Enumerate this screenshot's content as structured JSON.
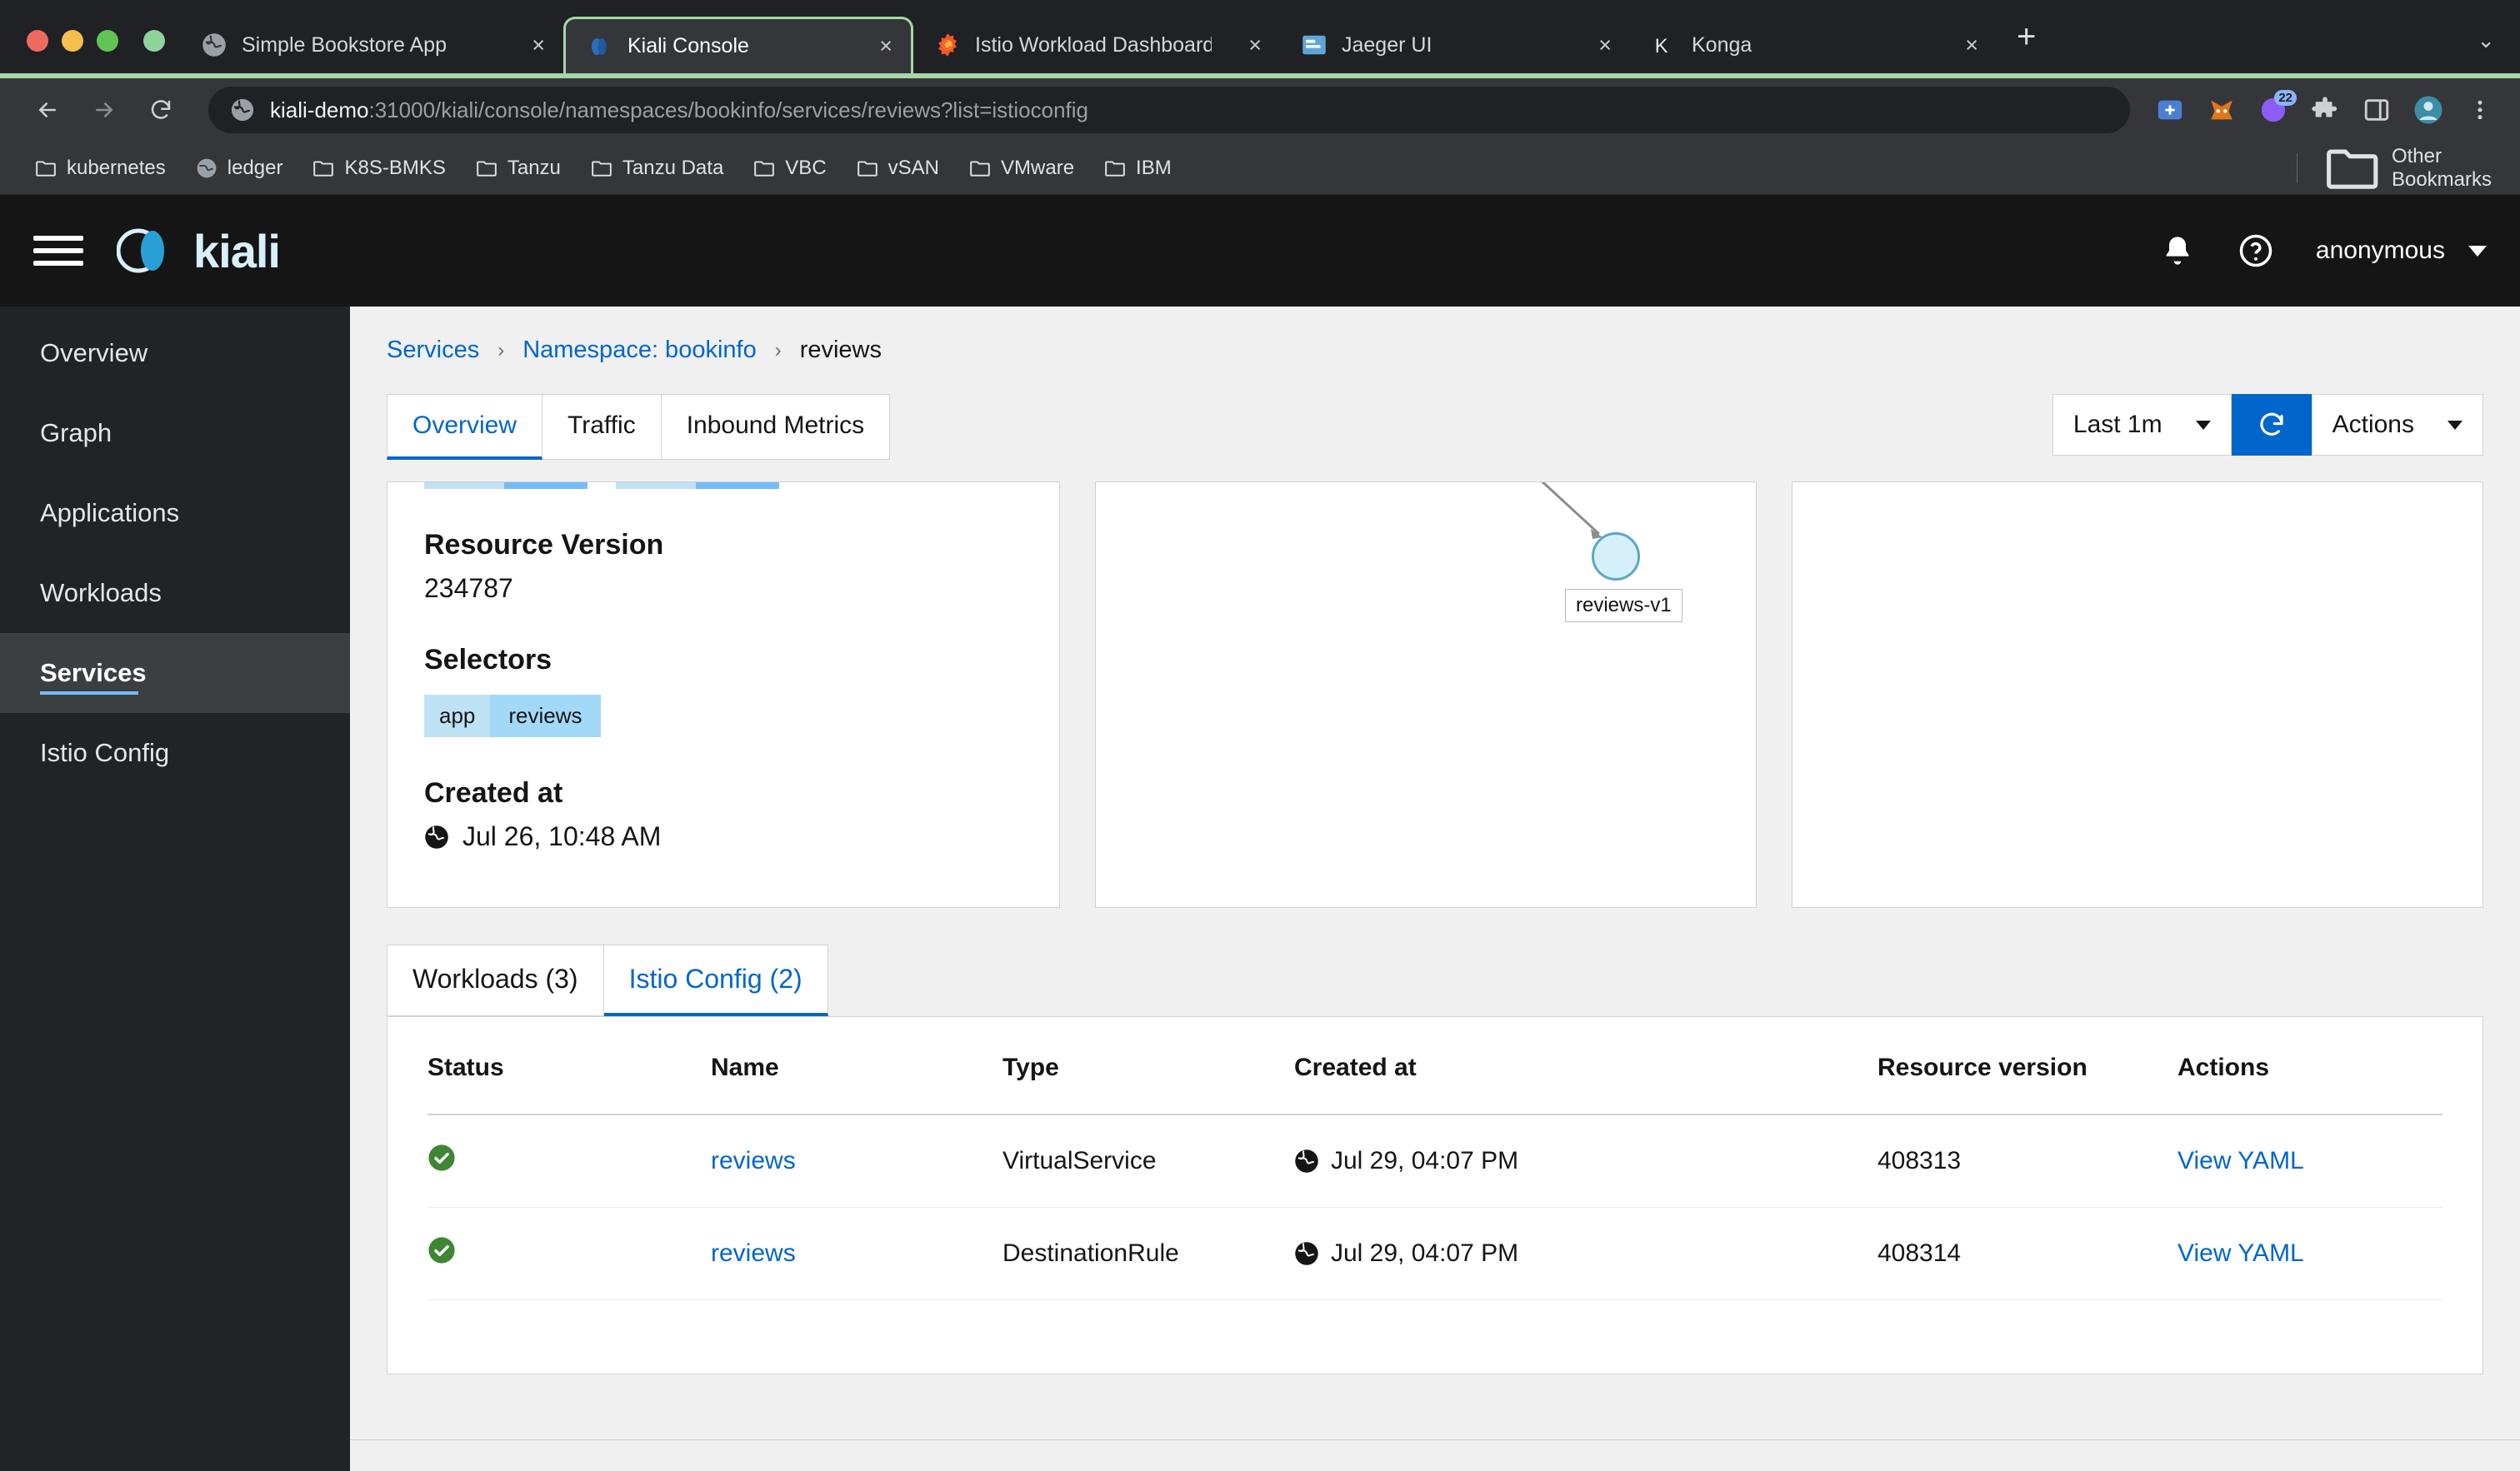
{
  "browser": {
    "tabs": [
      {
        "title": "Simple Bookstore App",
        "favicon": "globe-icon",
        "close": "×",
        "active": false
      },
      {
        "title": "Kiali Console",
        "favicon": "kiali-icon",
        "close": "×",
        "active": true
      },
      {
        "title": "Istio Workload Dashboard - Gra",
        "favicon": "grafana-icon",
        "close": "×",
        "active": false
      },
      {
        "title": "Jaeger UI",
        "favicon": "jaeger-icon",
        "close": "×",
        "active": false
      },
      {
        "title": "Konga",
        "favicon": "konga-icon",
        "close": "×",
        "active": false
      }
    ],
    "new_tab_label": "+",
    "tabstrip_overflow": "⌄",
    "omnibox": {
      "host": "kiali-demo",
      "path": ":31000/kiali/console/namespaces/bookinfo/services/reviews?list=istioconfig",
      "full_url": "kiali-demo:31000/kiali/console/namespaces/bookinfo/services/reviews?list=istioconfig"
    },
    "nav": {
      "back": "back-icon",
      "forward": "forward-icon",
      "reload": "reload-icon"
    },
    "extension_badge": "22",
    "bookmarks": [
      {
        "label": "kubernetes",
        "icon": "folder-icon"
      },
      {
        "label": "ledger",
        "icon": "globe-icon"
      },
      {
        "label": "K8S-BMKS",
        "icon": "folder-icon"
      },
      {
        "label": "Tanzu",
        "icon": "folder-icon"
      },
      {
        "label": "Tanzu Data",
        "icon": "folder-icon"
      },
      {
        "label": "VBC",
        "icon": "folder-icon"
      },
      {
        "label": "vSAN",
        "icon": "folder-icon"
      },
      {
        "label": "VMware",
        "icon": "folder-icon"
      },
      {
        "label": "IBM",
        "icon": "folder-icon"
      }
    ],
    "other_bookmarks": "Other Bookmarks"
  },
  "kiali": {
    "brand": "kiali",
    "header": {
      "menu_icon": "hamburger-icon",
      "bell_icon": "bell-icon",
      "help_icon": "help-icon",
      "user": "anonymous"
    },
    "sidebar": {
      "items": [
        {
          "label": "Overview",
          "active": false
        },
        {
          "label": "Graph",
          "active": false
        },
        {
          "label": "Applications",
          "active": false
        },
        {
          "label": "Workloads",
          "active": false
        },
        {
          "label": "Services",
          "active": true
        },
        {
          "label": "Istio Config",
          "active": false
        }
      ]
    },
    "breadcrumb": [
      {
        "label": "Services",
        "link": true
      },
      {
        "label": "Namespace: bookinfo",
        "link": true
      },
      {
        "label": "reviews",
        "link": false
      }
    ],
    "breadcrumb_separator": "›",
    "tabs": [
      {
        "label": "Overview",
        "active": true
      },
      {
        "label": "Traffic",
        "active": false
      },
      {
        "label": "Inbound Metrics",
        "active": false
      }
    ],
    "toolbar": {
      "time_range": "Last 1m",
      "refresh_icon": "refresh-icon",
      "actions_label": "Actions"
    },
    "overview_card": {
      "resource_version_label": "Resource Version",
      "resource_version_value": "234787",
      "selectors_label": "Selectors",
      "selector_key": "app",
      "selector_value": "reviews",
      "created_at_label": "Created at",
      "created_at_value": "Jul 26, 10:48 AM",
      "created_at_icon": "globe-icon"
    },
    "graph_card": {
      "node_label": "reviews-v1"
    },
    "bottom_tabs": [
      {
        "label": "Workloads (3)",
        "active": false
      },
      {
        "label": "Istio Config (2)",
        "active": true
      }
    ],
    "table": {
      "columns": [
        "Status",
        "Name",
        "Type",
        "Created at",
        "Resource version",
        "Actions"
      ],
      "rows": [
        {
          "status": "ok-icon",
          "name": "reviews",
          "type": "VirtualService",
          "created_at": "Jul 29, 04:07 PM",
          "created_at_icon": "globe-icon",
          "resource_version": "408313",
          "action": "View YAML"
        },
        {
          "status": "ok-icon",
          "name": "reviews",
          "type": "DestinationRule",
          "created_at": "Jul 29, 04:07 PM",
          "created_at_icon": "globe-icon",
          "resource_version": "408314",
          "action": "View YAML"
        }
      ]
    },
    "colors": {
      "accent_blue": "#06c",
      "status_green": "#3e8635",
      "chip_light": "#bee1f4",
      "chip_dark": "#a2d9f7",
      "active_tab_border": "#a5d6a7"
    }
  }
}
